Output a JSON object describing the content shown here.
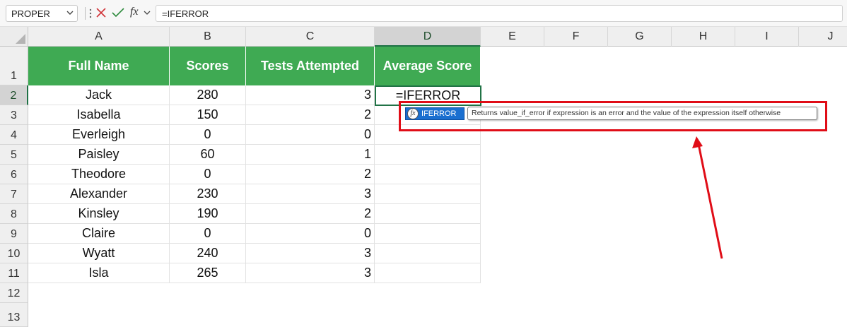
{
  "formula_bar": {
    "name_box": "PROPER",
    "fx_label": "fx",
    "formula": "=IFERROR"
  },
  "columns": [
    "A",
    "B",
    "C",
    "D",
    "E",
    "F",
    "G",
    "H",
    "I",
    "J"
  ],
  "rows": [
    "1",
    "2",
    "3",
    "4",
    "5",
    "6",
    "7",
    "8",
    "9",
    "10",
    "11",
    "12",
    "13"
  ],
  "table": {
    "headers": [
      "Full Name",
      "Scores",
      "Tests Attempted",
      "Average Score"
    ],
    "rows": [
      {
        "name": "Jack",
        "score": "280",
        "tests": "3"
      },
      {
        "name": "Isabella",
        "score": "150",
        "tests": "2"
      },
      {
        "name": "Everleigh",
        "score": "0",
        "tests": "0"
      },
      {
        "name": "Paisley",
        "score": "60",
        "tests": "1"
      },
      {
        "name": "Theodore",
        "score": "0",
        "tests": "2"
      },
      {
        "name": "Alexander",
        "score": "230",
        "tests": "3"
      },
      {
        "name": "Kinsley",
        "score": "190",
        "tests": "2"
      },
      {
        "name": "Claire",
        "score": "0",
        "tests": "0"
      },
      {
        "name": "Wyatt",
        "score": "240",
        "tests": "3"
      },
      {
        "name": "Isla",
        "score": "265",
        "tests": "3"
      }
    ]
  },
  "active_cell": {
    "ref": "D2",
    "content": "=IFERROR"
  },
  "autocomplete": {
    "item": "IFERROR",
    "tooltip": "Returns value_if_error if expression is an error and the value of the expression itself otherwise"
  },
  "colors": {
    "header_green": "#3faa53",
    "selection_green": "#217346",
    "annotation_red": "#e00d17",
    "autocomplete_blue": "#1a6fd0"
  }
}
